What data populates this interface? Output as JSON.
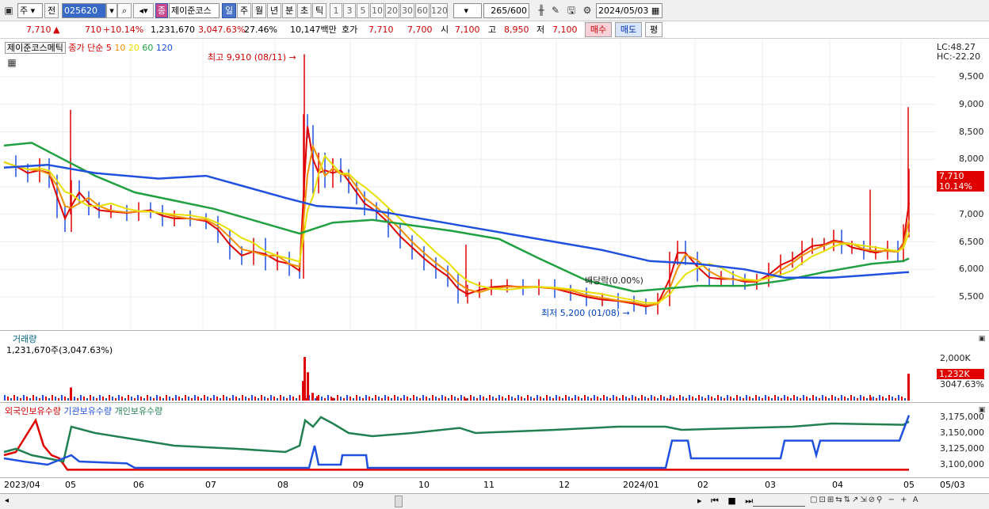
{
  "toolbar": {
    "market": "주",
    "prev_label": "전",
    "code": "025620",
    "name_badge": "종",
    "name": "제이준코스",
    "period_tabs": [
      "일",
      "주",
      "월",
      "년",
      "분",
      "초",
      "틱"
    ],
    "period_active": "일",
    "minute_options": [
      "1",
      "3",
      "5",
      "10",
      "20",
      "30",
      "60",
      "120"
    ],
    "count": "265",
    "count_max": "/600",
    "date": "2024/05/03"
  },
  "quote": {
    "price": "7,710",
    "up_arrow": "▲",
    "change": "710",
    "change_pct": "+10.14%",
    "volume": "1,231,670",
    "volume_ratio": "3,047.63%",
    "turnover": "27.46%",
    "amount": "10,147백만",
    "hoga_label": "호가",
    "ask": "7,710",
    "bid": "7,700",
    "open_label": "시",
    "open": "7,100",
    "high_label": "고",
    "high": "8,950",
    "low_label": "저",
    "low": "7,100",
    "buy_btn": "매수",
    "sell_btn": "매도",
    "eval_btn": "평"
  },
  "price_pane": {
    "title_name": "제이준코스메틱",
    "ma_label": "종가 단순",
    "ma_periods": [
      "5",
      "10",
      "20",
      "60",
      "120"
    ],
    "ma_colors": [
      "#e00000",
      "#f09000",
      "#e8e000",
      "#20a040",
      "#2050e0"
    ],
    "high_annot": "최고 9,910 (08/11)",
    "low_annot": "최저 5,200 (01/08)",
    "dividend_annot": "배당락(0.00%)",
    "lc": "LC:48.27",
    "hc": "HC:-22.20",
    "price_tag": "7,710",
    "price_tag_pct": "10.14%",
    "y_ticks": [
      "9,500",
      "9,000",
      "8,500",
      "8,000",
      "7,500",
      "7,000",
      "6,500",
      "6,000",
      "5,500"
    ]
  },
  "volume_pane": {
    "title": "거래량",
    "value": "1,231,670주(3,047.63%)",
    "y_tick": "2,000K",
    "tag": "1,232K",
    "tag_pct": "3047.63%"
  },
  "holding_pane": {
    "foreign_label": "외국인보유수량",
    "inst_label": "기관보유수량",
    "indiv_label": "개인보유수량",
    "y_ticks": [
      "3,175,000",
      "3,150,000",
      "3,125,000",
      "3,100,000"
    ]
  },
  "x_axis": [
    "2023/04",
    "05",
    "06",
    "07",
    "08",
    "09",
    "10",
    "11",
    "12",
    "2024/01",
    "02",
    "03",
    "04",
    "05",
    "05/03"
  ],
  "chart_data": {
    "type": "line",
    "title": "",
    "price_range": [
      5200,
      9910
    ],
    "annotations": {
      "high": 9910,
      "low": 5200,
      "last": 7710
    },
    "volume_last": 1231670
  }
}
